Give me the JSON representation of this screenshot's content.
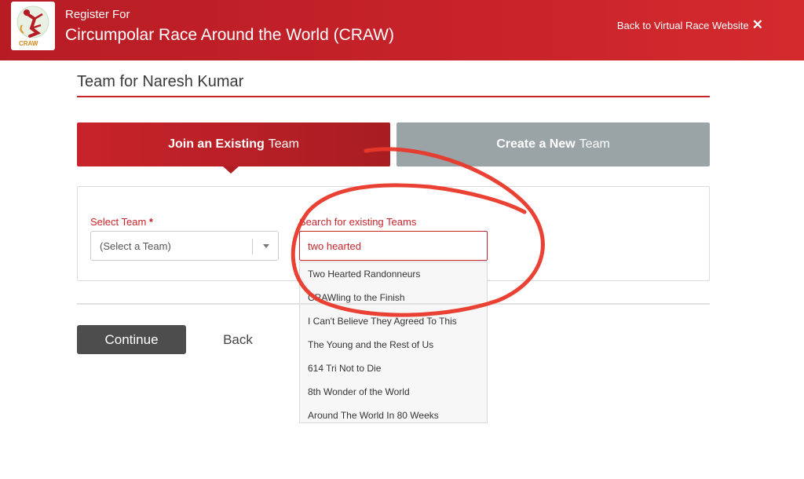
{
  "header": {
    "pre_title": "Register For",
    "title": "Circumpolar Race Around the World (CRAW)",
    "back_link": "Back to Virtual Race Website",
    "close_glyph": "✕",
    "logo_text": "CRAW"
  },
  "page": {
    "title": "Team for Naresh Kumar"
  },
  "tabs": {
    "join_bold": "Join an Existing",
    "join_rest": "Team",
    "create_bold": "Create a New",
    "create_rest": "Team"
  },
  "form": {
    "select_label": "Select Team",
    "required_mark": "*",
    "select_value": "(Select a Team)",
    "search_label": "Search for existing Teams",
    "search_value": "two hearted"
  },
  "dropdown": {
    "items": [
      "Two Hearted Randonneurs",
      "CRAWling to the Finish",
      "I Can't Believe They Agreed To This",
      "The Young and the Rest of Us",
      "614 Tri Not to Die",
      "8th Wonder of the World",
      "Around The World In 80 Weeks"
    ]
  },
  "actions": {
    "continue": "Continue",
    "back": "Back"
  },
  "colors": {
    "brand_red": "#c8232a",
    "inactive_tab": "#9aa4a6",
    "continue_bg": "#4d4d4d",
    "annotation": "#e8382a"
  }
}
